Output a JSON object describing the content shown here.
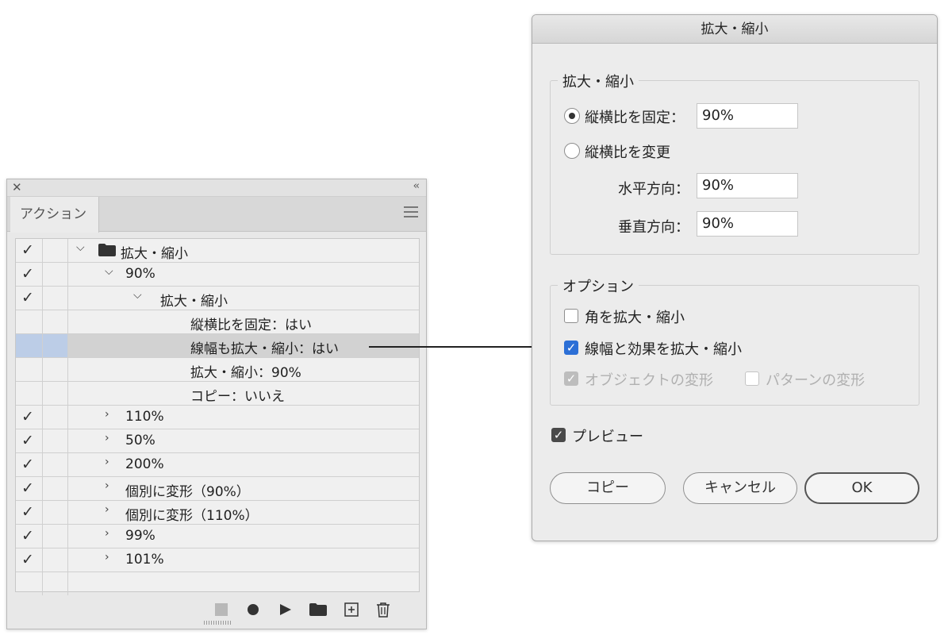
{
  "actions_panel": {
    "tab_label": "アクション",
    "rows": [
      {
        "checked": true,
        "expanded": true,
        "folder": true,
        "label": "拡大・縮小"
      },
      {
        "checked": true,
        "expanded": true,
        "label": "90%"
      },
      {
        "checked": true,
        "expanded": true,
        "label": "拡大・縮小"
      },
      {
        "checked": false,
        "label": "縦横比を固定：はい"
      },
      {
        "checked": false,
        "selected": true,
        "label": "線幅も拡大・縮小：はい"
      },
      {
        "checked": false,
        "label": "拡大・縮小：90%"
      },
      {
        "checked": false,
        "label": "コピー：いいえ"
      },
      {
        "checked": true,
        "expanded": false,
        "label": "110%"
      },
      {
        "checked": true,
        "expanded": false,
        "label": "50%"
      },
      {
        "checked": true,
        "expanded": false,
        "label": "200%"
      },
      {
        "checked": true,
        "expanded": false,
        "label": "個別に変形（90%）"
      },
      {
        "checked": true,
        "expanded": false,
        "label": "個別に変形（110%）"
      },
      {
        "checked": true,
        "expanded": false,
        "label": "99%"
      },
      {
        "checked": true,
        "expanded": false,
        "label": "101%"
      }
    ],
    "footer_icons": [
      "stop-icon",
      "record-icon",
      "play-icon",
      "folder-icon",
      "new-action-icon",
      "trash-icon"
    ]
  },
  "dialog": {
    "title": "拡大・縮小",
    "scale_group": {
      "legend": "拡大・縮小",
      "uniform_label": "縦横比を固定：",
      "uniform_value": "90%",
      "uniform_selected": true,
      "nonuniform_label": "縦横比を変更",
      "horizontal_label": "水平方向：",
      "horizontal_value": "90%",
      "vertical_label": "垂直方向：",
      "vertical_value": "90%"
    },
    "options_group": {
      "legend": "オプション",
      "scale_corners_label": "角を拡大・縮小",
      "scale_corners_checked": false,
      "scale_strokes_label": "線幅と効果を拡大・縮小",
      "scale_strokes_checked": true,
      "transform_objects_label": "オブジェクトの変形",
      "transform_patterns_label": "パターンの変形"
    },
    "preview_label": "プレビュー",
    "preview_checked": true,
    "copy_button": "コピー",
    "cancel_button": "キャンセル",
    "ok_button": "OK"
  },
  "colors": {
    "selection_blue": "#bccde7",
    "checkbox_blue": "#2c6fd6"
  }
}
